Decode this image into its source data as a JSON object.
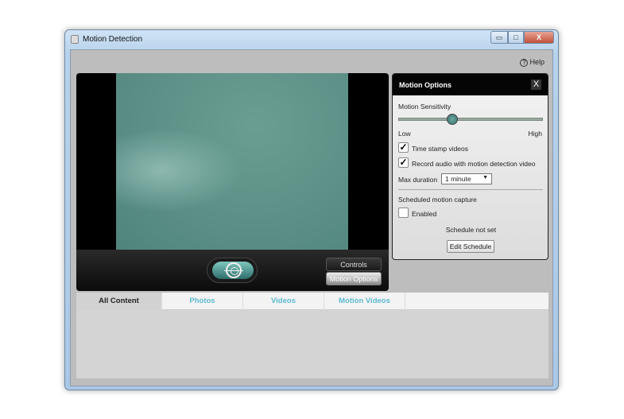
{
  "window": {
    "title": "Motion Detection",
    "minimize": "▭",
    "maximize": "□",
    "close": "X"
  },
  "help": {
    "label": "Help",
    "icon": "?"
  },
  "video": {
    "controls_label": "Controls",
    "motion_options_label": "Motion Options"
  },
  "panel": {
    "title": "Motion Options",
    "close": "X",
    "sensitivity_label": "Motion Sensitivity",
    "sensitivity_value": 0.37,
    "low": "Low",
    "high": "High",
    "timestamp": {
      "label": "Time stamp videos",
      "checked": true
    },
    "record_audio": {
      "label": "Record audio with motion detection video",
      "checked": true
    },
    "max_duration_label": "Max duration",
    "max_duration_value": "1 minute",
    "scheduled_label": "Scheduled motion capture",
    "enabled": {
      "label": "Enabled",
      "checked": false
    },
    "schedule_status": "Schedule not set",
    "edit_schedule": "Edit Schedule"
  },
  "tabs": [
    {
      "label": "All Content",
      "active": true
    },
    {
      "label": "Photos"
    },
    {
      "label": "Videos"
    },
    {
      "label": "Motion Videos"
    }
  ]
}
